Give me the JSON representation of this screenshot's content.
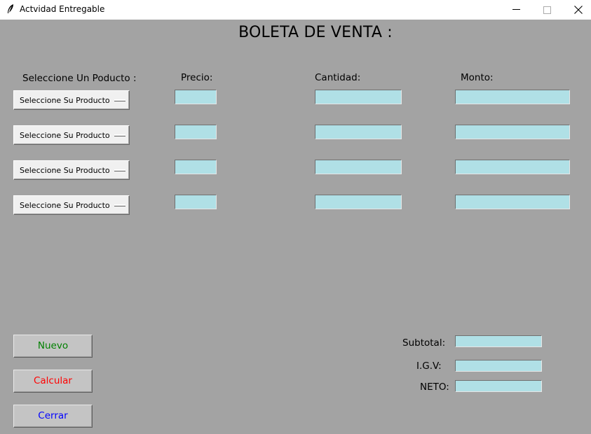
{
  "window": {
    "title": "Actvidad Entregable",
    "minimize_glyph": "—",
    "maximize_glyph": "☐",
    "close_glyph": "✕"
  },
  "heading": "BOLETA DE VENTA :",
  "columns": {
    "product": "Seleccione Un Poducto :",
    "price": "Precio:",
    "quantity": "Cantidad:",
    "amount": "Monto:"
  },
  "rows": [
    {
      "product": "Seleccione Su Producto",
      "price": "",
      "quantity": "",
      "amount": ""
    },
    {
      "product": "Seleccione Su Producto",
      "price": "",
      "quantity": "",
      "amount": ""
    },
    {
      "product": "Seleccione Su Producto",
      "price": "",
      "quantity": "",
      "amount": ""
    },
    {
      "product": "Seleccione Su Producto",
      "price": "",
      "quantity": "",
      "amount": ""
    }
  ],
  "buttons": {
    "new": {
      "label": "Nuevo",
      "color": "#008000"
    },
    "calculate": {
      "label": "Calcular",
      "color": "#ff0000"
    },
    "close": {
      "label": "Cerrar",
      "color": "#0000ff"
    }
  },
  "totals": {
    "subtotal_label": "Subtotal:",
    "igv_label": "I.G.V:",
    "neto_label": "NETO:",
    "subtotal": "",
    "igv": "",
    "neto": ""
  },
  "colors": {
    "window_bg": "#a3a3a3",
    "entry_bg": "#b0e0e6",
    "button_bg": "#c4c4c4"
  }
}
